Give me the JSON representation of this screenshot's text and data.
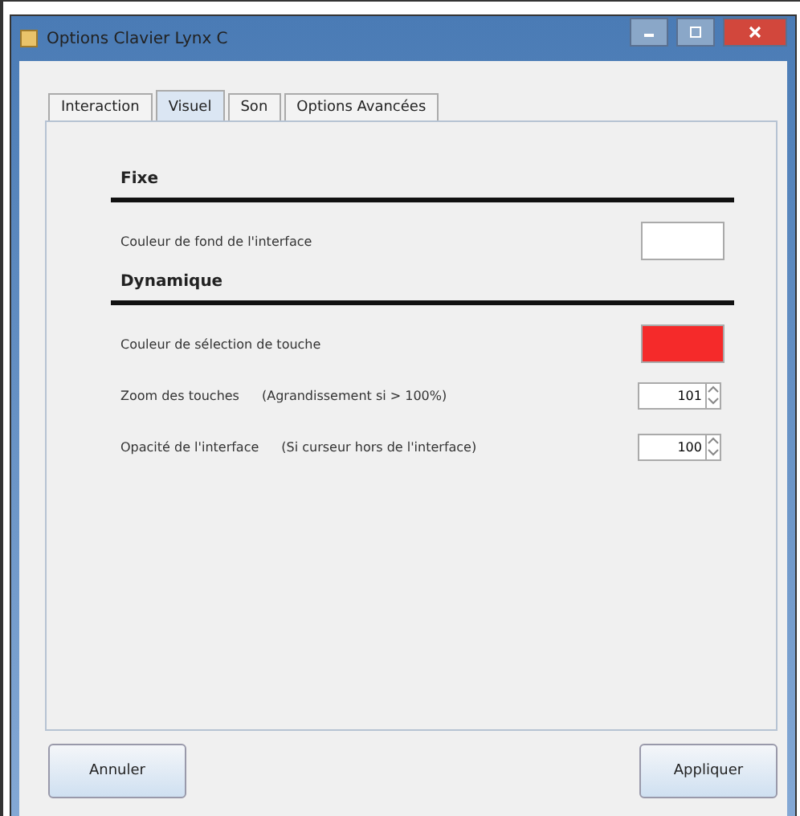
{
  "window": {
    "title": "Options Clavier Lynx C"
  },
  "tabs": [
    {
      "label": "Interaction",
      "selected": false
    },
    {
      "label": "Visuel",
      "selected": true
    },
    {
      "label": "Son",
      "selected": false
    },
    {
      "label": "Options Avancées",
      "selected": false
    }
  ],
  "sections": [
    {
      "title": "Fixe",
      "rows": [
        {
          "kind": "color",
          "label": "Couleur de fond de l'interface",
          "color": "#ffffff"
        }
      ]
    },
    {
      "title": "Dynamique",
      "rows": [
        {
          "kind": "color",
          "label": "Couleur de sélection de touche",
          "color": "#f52a2a"
        },
        {
          "kind": "spinner",
          "label": "Zoom des touches",
          "hint": "(Agrandissement si > 100%)",
          "value": "101"
        },
        {
          "kind": "spinner",
          "label": "Opacité de l'interface",
          "hint": "(Si curseur hors de l'interface)",
          "value": "100"
        }
      ]
    }
  ],
  "buttons": [
    "Annuler",
    "Appliquer"
  ]
}
